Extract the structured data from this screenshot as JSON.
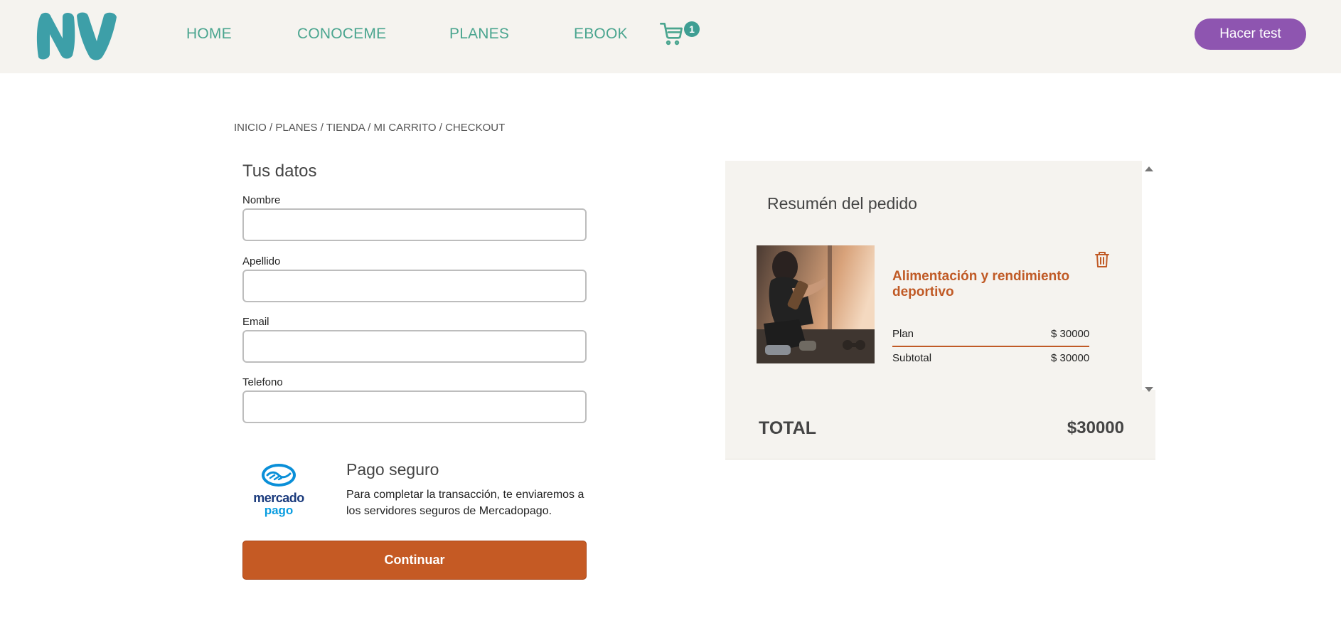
{
  "header": {
    "logo_text": "NV",
    "nav": [
      "HOME",
      "CONOCEME",
      "PLANES",
      "EBOOK"
    ],
    "cart_count": "1",
    "cta_label": "Hacer test"
  },
  "breadcrumb": [
    "INICIO",
    "PLANES",
    "TIENDA",
    "MI CARRITO",
    "CHECKOUT"
  ],
  "form": {
    "title": "Tus datos",
    "fields": [
      {
        "label": "Nombre",
        "value": ""
      },
      {
        "label": "Apellido",
        "value": ""
      },
      {
        "label": "Email",
        "value": ""
      },
      {
        "label": "Telefono",
        "value": ""
      }
    ],
    "payment": {
      "logo_text_1": "mercado",
      "logo_text_2": "pago",
      "title": "Pago seguro",
      "text": "Para completar la transacción, te enviaremos a los servidores seguros de Mercadopago."
    },
    "submit_label": "Continuar"
  },
  "summary": {
    "title": "Resumén del pedido",
    "item": {
      "name": "Alimentación y rendimiento deportivo",
      "rows": [
        {
          "label": "Plan",
          "value": "$ 30000"
        },
        {
          "label": "Subtotal",
          "value": "$ 30000"
        }
      ]
    },
    "total_label": "TOTAL",
    "total_value": "$30000"
  },
  "colors": {
    "teal": "#3e9e93",
    "purple": "#8e55b0",
    "orange": "#c55a24",
    "beige": "#f5f3ef"
  }
}
